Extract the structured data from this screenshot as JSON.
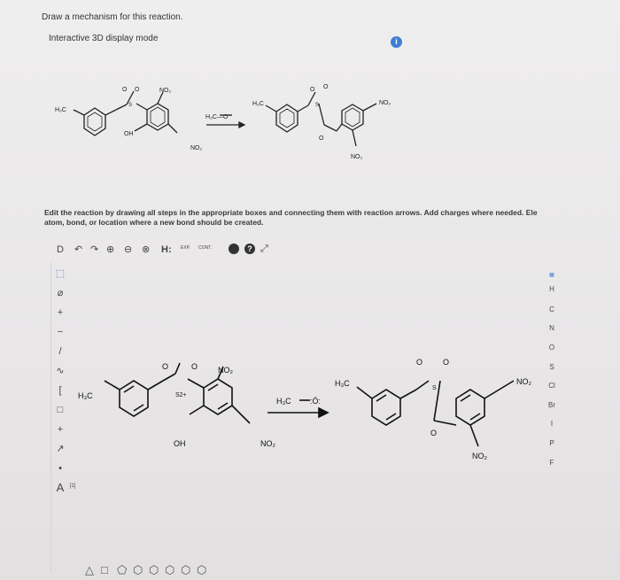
{
  "header": {
    "instruction": "Draw a mechanism for this reaction.",
    "mode_label": "Interactive 3D display mode",
    "info_icon": "i"
  },
  "prompt": {
    "line1": "Edit the reaction by drawing all steps in the appropriate boxes and connecting them with reaction arrows. Add charges where needed. Ele",
    "line2": "atom, bond, or location where a new bond should be created."
  },
  "reaction_top": {
    "reagent": "H₃C—O⁻",
    "left_molecule_labels": [
      "H₃C",
      "O",
      "O",
      "S",
      "NO₂",
      "OH",
      "NO₂"
    ],
    "right_molecule_labels": [
      "H₃C",
      "O",
      "O",
      "S",
      "NO₂",
      "O",
      "NO₂"
    ]
  },
  "editor": {
    "toolbar": {
      "new_icon": "D",
      "undo_icon": "↶",
      "redo_icon": "↷",
      "zoom_in_icon": "⊕",
      "zoom_out_icon": "⊖",
      "clean_icon": "⊗",
      "hydrogen_label": "H:",
      "exp_label": "EXP.",
      "cont_label": "CONT.",
      "help_icon": "?",
      "expand_icon": "⤢"
    },
    "left_tools": [
      "⬚",
      "⌀",
      "+",
      "−",
      "/",
      "∿",
      "[",
      "□",
      "+",
      "↗",
      "•",
      "A"
    ],
    "left_tool_extra": "[1]",
    "elements": [
      "H",
      "C",
      "N",
      "O",
      "S",
      "Cl",
      "Br",
      "I",
      "P",
      "F"
    ],
    "reaction_canvas": {
      "reagent_left": "H₃C",
      "reagent_o": ":Ö:",
      "left_labels": [
        "H₃C",
        "O",
        "O",
        "S2+",
        "NO₂",
        "OH",
        "NO₂"
      ],
      "right_labels": [
        "H₃C",
        "O",
        "O",
        "S",
        "NO₂",
        "O",
        "NO₂"
      ]
    },
    "bottom_shapes": [
      "△",
      "□",
      "⬠",
      "⬡",
      "⬡",
      "⬡",
      "⬡",
      "⬡"
    ]
  }
}
